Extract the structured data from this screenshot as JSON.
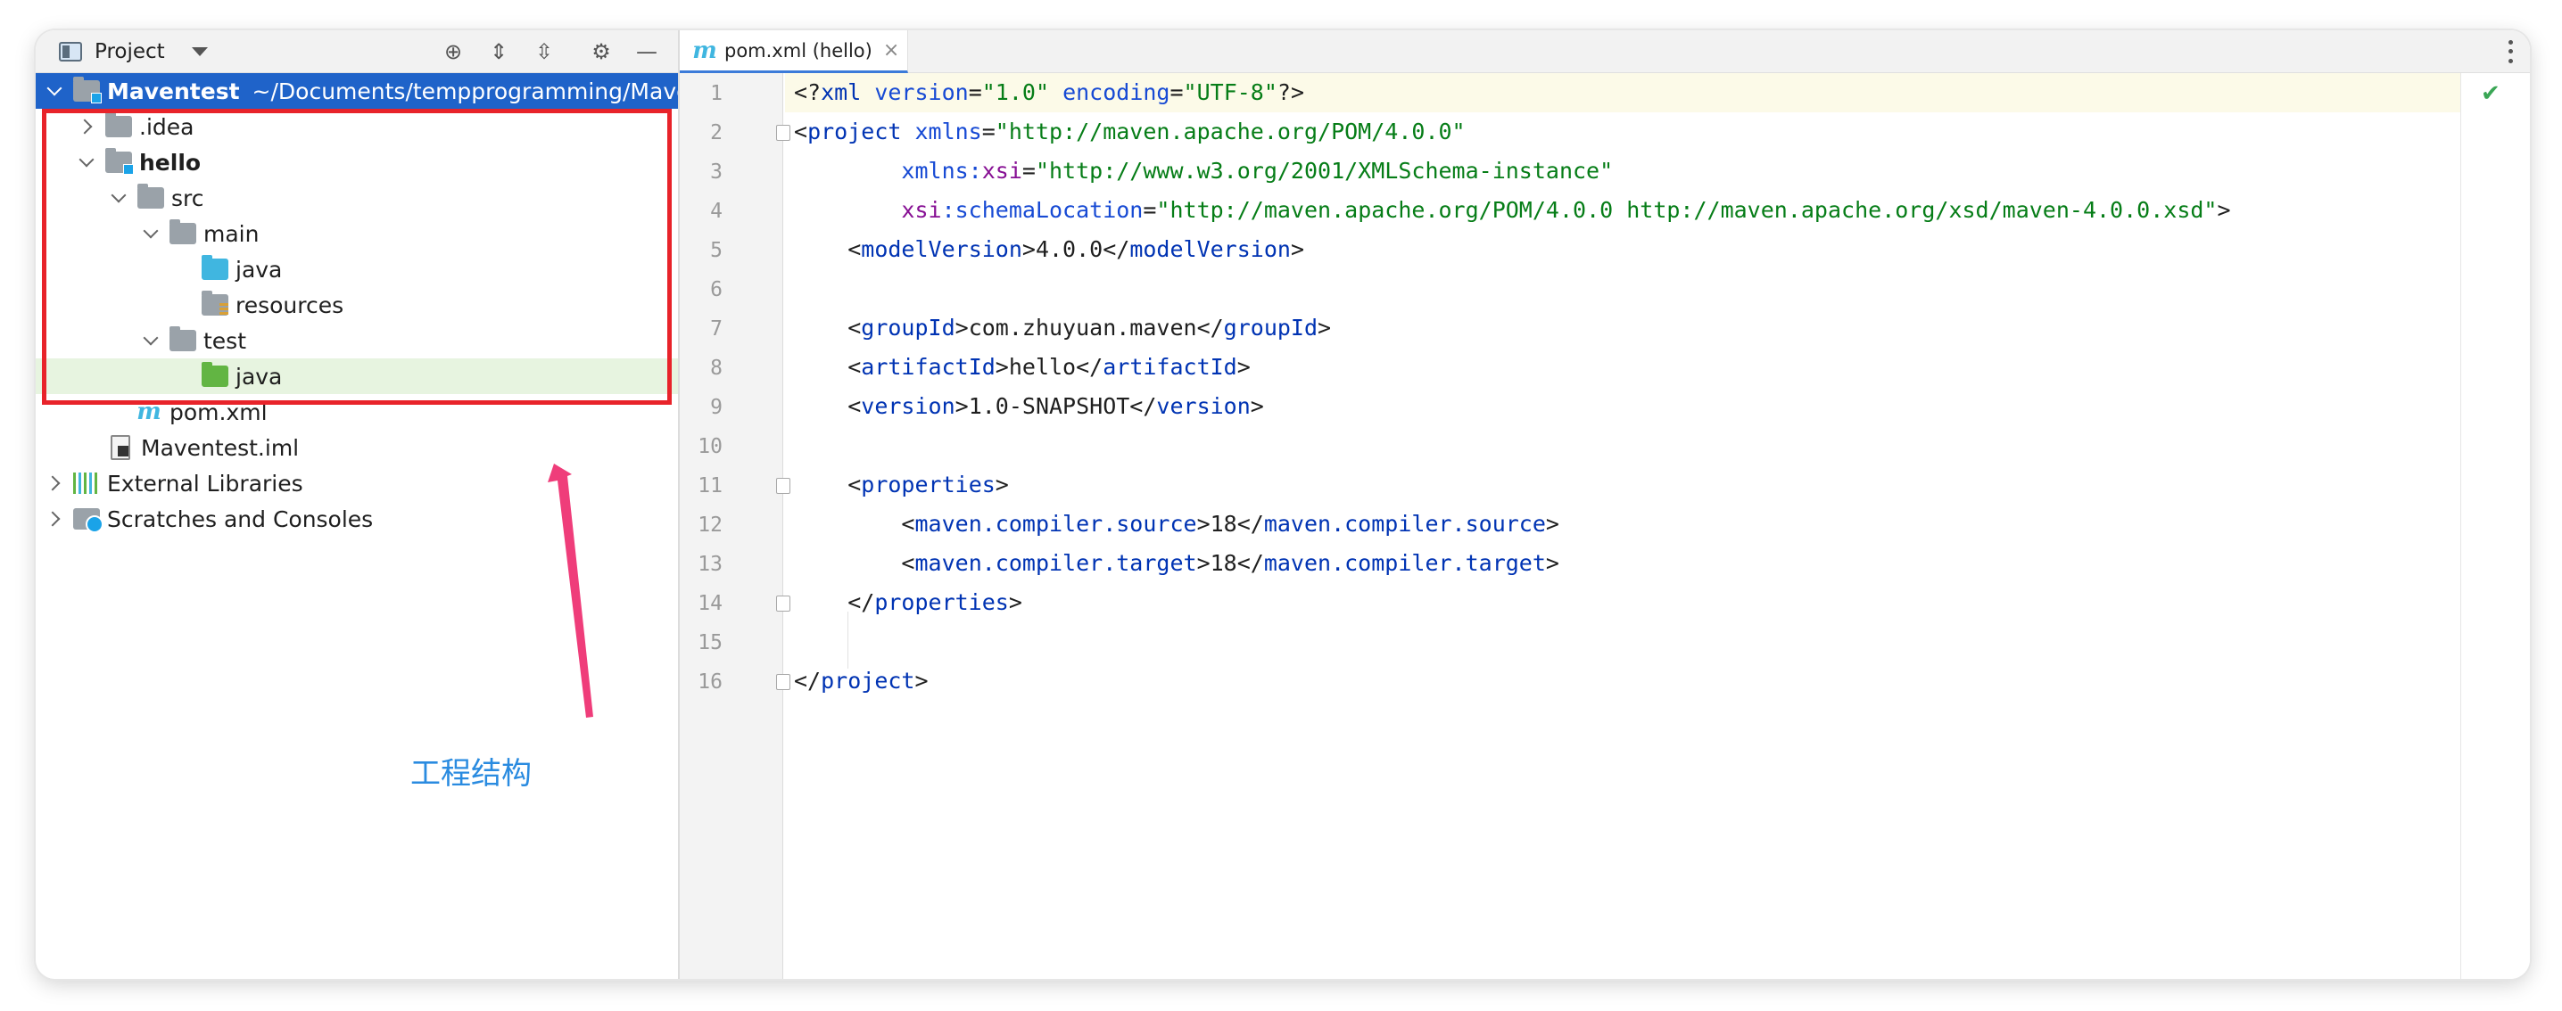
{
  "project_panel": {
    "title": "Project",
    "tree": {
      "root": {
        "label": "Maventest",
        "path": "~/Documents/tempprogramming/Maventest"
      },
      "idea": ".idea",
      "hello": "hello",
      "src": "src",
      "main": "main",
      "main_java": "java",
      "resources": "resources",
      "test": "test",
      "test_java": "java",
      "pom": "pom.xml",
      "iml": "Maventest.iml",
      "external_libraries": "External Libraries",
      "scratches": "Scratches and Consoles"
    }
  },
  "annotation": {
    "label": "工程结构",
    "box_color": "#e8232a",
    "arrow_color": "#ef3d7a",
    "text_color": "#2a8be0"
  },
  "editor": {
    "tab": {
      "label": "pom.xml (hello)",
      "close": "×"
    },
    "line_numbers": [
      "1",
      "2",
      "3",
      "4",
      "5",
      "6",
      "7",
      "8",
      "9",
      "10",
      "11",
      "12",
      "13",
      "14",
      "15",
      "16"
    ],
    "code": [
      {
        "p1": "<?",
        "t1": "xml",
        "a1": " version",
        "p2": "=",
        "v1": "\"1.0\"",
        "a2": " encoding",
        "p3": "=",
        "v2": "\"UTF-8\"",
        "p4": "?>"
      },
      {
        "p1": "<",
        "t1": "project",
        "a1": " xmlns",
        "p2": "=",
        "v1": "\"http://maven.apache.org/POM/4.0.0\""
      },
      {
        "indent": "        ",
        "a1": "xmlns:",
        "ns": "xsi",
        "p2": "=",
        "v1": "\"http://www.w3.org/2001/XMLSchema-instance\""
      },
      {
        "indent": "        ",
        "ns": "xsi",
        "a1": ":schemaLocation",
        "p2": "=",
        "v1": "\"http://maven.apache.org/POM/4.0.0 http://maven.apache.org/xsd/maven-4.0.0.xsd\"",
        "p3": ">"
      },
      {
        "indent": "    ",
        "p1": "<",
        "t1": "modelVersion",
        "p2": ">4.0.0</",
        "t2": "modelVersion",
        "p3": ">"
      },
      {},
      {
        "indent": "    ",
        "p1": "<",
        "t1": "groupId",
        "p2": ">com.zhuyuan.maven</",
        "t2": "groupId",
        "p3": ">"
      },
      {
        "indent": "    ",
        "p1": "<",
        "t1": "artifactId",
        "p2": ">hello</",
        "t2": "artifactId",
        "p3": ">"
      },
      {
        "indent": "    ",
        "p1": "<",
        "t1": "version",
        "p2": ">1.0-SNAPSHOT</",
        "t2": "version",
        "p3": ">"
      },
      {},
      {
        "indent": "    ",
        "p1": "<",
        "t1": "properties",
        "p2": ">"
      },
      {
        "indent": "        ",
        "p1": "<",
        "t1": "maven.compiler.source",
        "p2": ">18</",
        "t2": "maven.compiler.source",
        "p3": ">"
      },
      {
        "indent": "        ",
        "p1": "<",
        "t1": "maven.compiler.target",
        "p2": ">18</",
        "t2": "maven.compiler.target",
        "p3": ">"
      },
      {
        "indent": "    ",
        "p1": "</",
        "t1": "properties",
        "p2": ">"
      },
      {},
      {
        "p1": "</",
        "t1": "project",
        "p2": ">"
      }
    ],
    "inspection": "✔"
  }
}
